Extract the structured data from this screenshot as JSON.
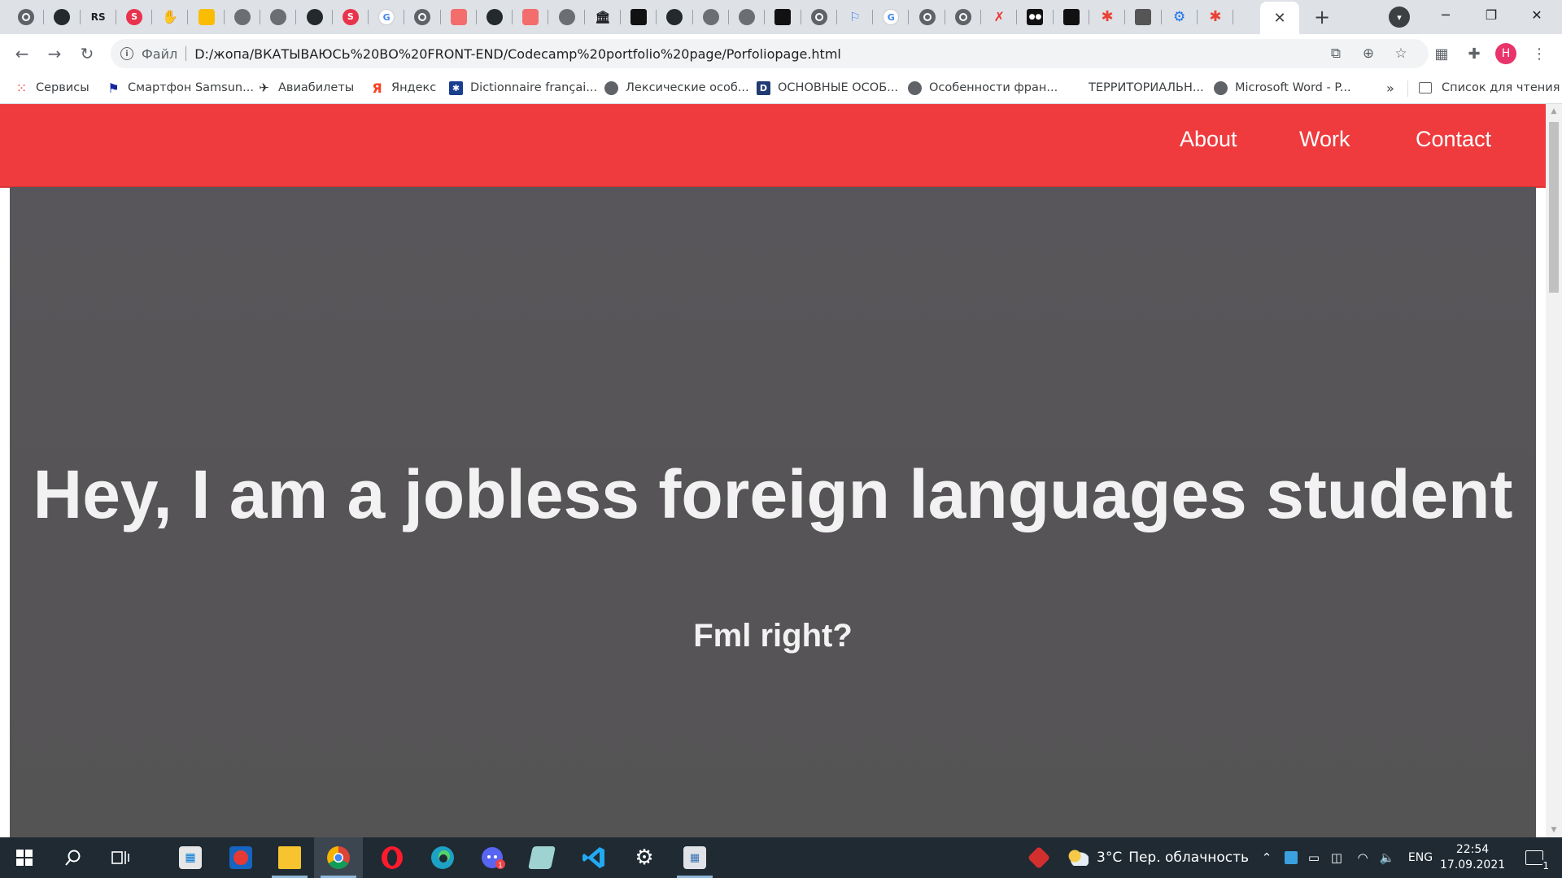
{
  "browser": {
    "tabs": [
      {
        "icon": "chrome-icon",
        "glyph": ""
      },
      {
        "icon": "github-icon",
        "glyph": ""
      },
      {
        "icon": "rs-icon",
        "glyph": "RS"
      },
      {
        "icon": "red-shield-icon",
        "glyph": "S"
      },
      {
        "icon": "hand-icon",
        "glyph": "✋"
      },
      {
        "icon": "yellow-app-icon",
        "glyph": ""
      },
      {
        "icon": "globe-icon",
        "glyph": ""
      },
      {
        "icon": "globe-icon",
        "glyph": ""
      },
      {
        "icon": "github-icon",
        "glyph": ""
      },
      {
        "icon": "red-shield-icon",
        "glyph": "S"
      },
      {
        "icon": "google-icon",
        "glyph": "G"
      },
      {
        "icon": "chrome-icon",
        "glyph": ""
      },
      {
        "icon": "pink-box-icon",
        "glyph": ""
      },
      {
        "icon": "github-icon",
        "glyph": ""
      },
      {
        "icon": "pink-box-icon",
        "glyph": ""
      },
      {
        "icon": "globe-icon",
        "glyph": ""
      },
      {
        "icon": "bank-icon",
        "glyph": "🏛"
      },
      {
        "icon": "black-box-icon",
        "glyph": ""
      },
      {
        "icon": "github-icon",
        "glyph": ""
      },
      {
        "icon": "globe-icon",
        "glyph": ""
      },
      {
        "icon": "globe-icon",
        "glyph": ""
      },
      {
        "icon": "black-box-icon",
        "glyph": ""
      },
      {
        "icon": "chrome-icon",
        "glyph": ""
      },
      {
        "icon": "flag-icon",
        "glyph": "⚐"
      },
      {
        "icon": "google-icon",
        "glyph": "G"
      },
      {
        "icon": "chrome-icon",
        "glyph": ""
      },
      {
        "icon": "chrome-icon",
        "glyph": ""
      },
      {
        "icon": "red-man-icon",
        "glyph": "✗"
      },
      {
        "icon": "medium-icon",
        "glyph": "●●"
      },
      {
        "icon": "black-box-icon",
        "glyph": ""
      },
      {
        "icon": "red-asterisk-icon",
        "glyph": "✱"
      },
      {
        "icon": "photo-icon",
        "glyph": ""
      },
      {
        "icon": "gear-icon",
        "glyph": "⚙"
      },
      {
        "icon": "red-asterisk-icon",
        "glyph": "✱"
      }
    ],
    "active_tab_close": "✕",
    "new_tab": "+",
    "file_label": "Файл",
    "url": "D:/жопа/ВКАТЫВАЮСЬ%20ВО%20FRONT-END/Codecamp%20portfolio%20page/Porfoliopage.html",
    "profile_initial": "H",
    "bookmarks": [
      {
        "label": "Сервисы",
        "icon": "apps-icon"
      },
      {
        "label": "Смартфон Samsun...",
        "icon": "samsung-icon"
      },
      {
        "label": "Авиабилеты",
        "icon": "plane-icon"
      },
      {
        "label": "Яндекс",
        "icon": "yandex-icon"
      },
      {
        "label": "Dictionnaire françai...",
        "icon": "dictionary-icon"
      },
      {
        "label": "Лексические особ...",
        "icon": "globe-icon"
      },
      {
        "label": "ОСНОВНЫЕ ОСОБ...",
        "icon": "d-icon"
      },
      {
        "label": "Особенности фран...",
        "icon": "globe-icon"
      },
      {
        "label": "ТЕРРИТОРИАЛЬН...",
        "icon": "none"
      },
      {
        "label": "Microsoft Word - P...",
        "icon": "globe-icon"
      }
    ],
    "bookmarks_more": "»",
    "reading_list": "Список для чтения"
  },
  "page": {
    "nav": {
      "about": "About",
      "work": "Work",
      "contact": "Contact"
    },
    "hero": {
      "title": "Hey, I am a jobless foreign languages student",
      "subtitle": "Fml right?"
    },
    "colors": {
      "nav_background": "#ef3b3d",
      "hero_background": "#565456",
      "hero_text": "#f2f2f2"
    }
  },
  "taskbar": {
    "weather_temp": "3°C",
    "weather_text": "Пер. облачность",
    "language": "ENG",
    "time": "22:54",
    "date": "17.09.2021",
    "notifications": "1"
  }
}
